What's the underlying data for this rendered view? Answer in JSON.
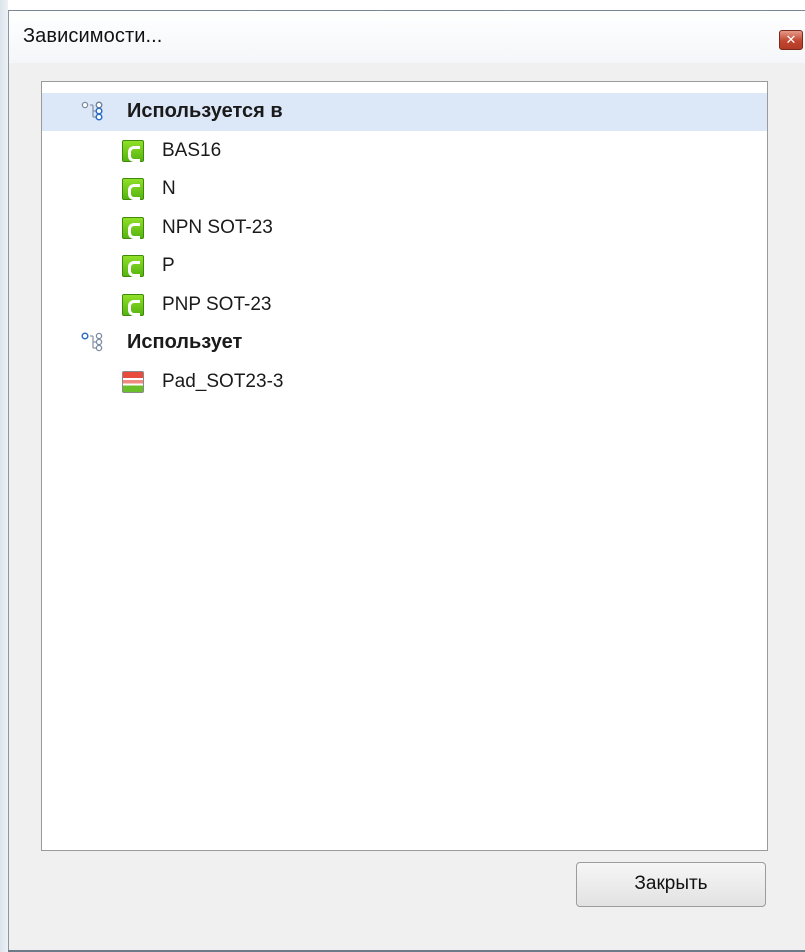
{
  "window": {
    "title": "Зависимости...",
    "close_glyph": "✕"
  },
  "tree": {
    "groups": [
      {
        "label": "Используется в",
        "icon": "tree-hierarchy-icon",
        "selected": true,
        "items": [
          {
            "label": "BAS16",
            "icon": "component-icon"
          },
          {
            "label": "N",
            "icon": "component-icon"
          },
          {
            "label": "NPN SOT-23",
            "icon": "component-icon"
          },
          {
            "label": "P",
            "icon": "component-icon"
          },
          {
            "label": "PNP SOT-23",
            "icon": "component-icon"
          }
        ]
      },
      {
        "label": "Использует",
        "icon": "tree-hierarchy-icon",
        "selected": false,
        "items": [
          {
            "label": "Pad_SOT23-3",
            "icon": "pad-stack-icon"
          }
        ]
      }
    ]
  },
  "footer": {
    "close_label": "Закрыть"
  },
  "colors": {
    "selection": "#dce8f8",
    "component_green": "#5fbf14",
    "pad_red": "#e84c3c",
    "close_red": "#c2462f"
  }
}
